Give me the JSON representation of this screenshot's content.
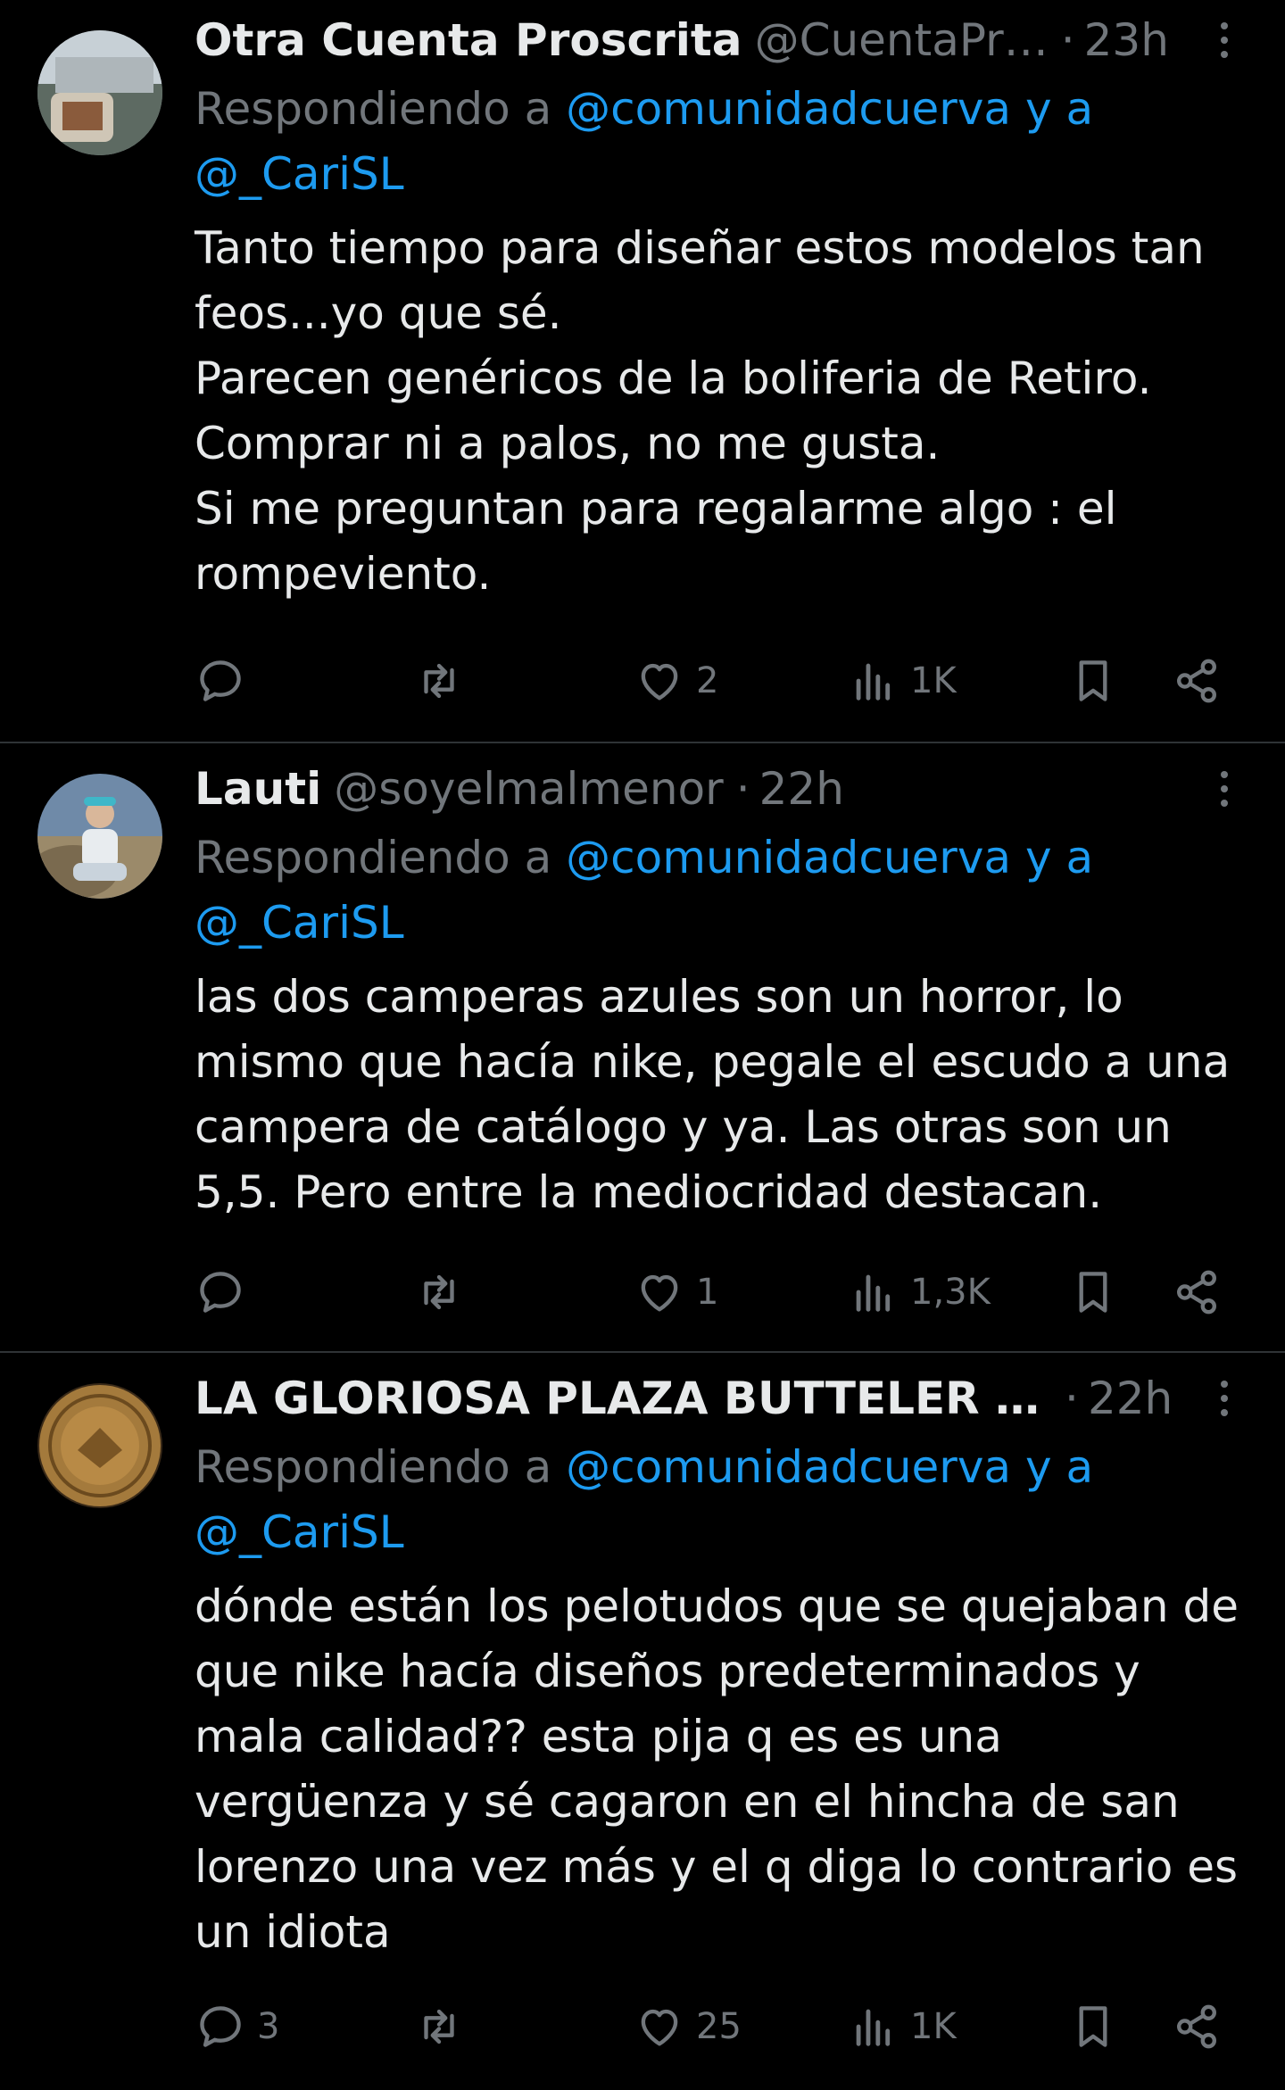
{
  "tweets": [
    {
      "name": "Otra Cuenta Proscrita",
      "handle": "@CuentaPr…",
      "time": "23h",
      "replying_prefix": "Respondiendo a ",
      "replying_mentions": "@comunidadcuerva y a",
      "replying_mentions2": "@_CariSL",
      "text": "Tanto tiempo para diseñar estos modelos tan feos...yo que sé.\nParecen genéricos de la boliferia de Retiro.\nComprar ni a palos, no me gusta.\nSi me preguntan para regalarme algo : el rompeviento.",
      "replies": "",
      "retweets": "",
      "likes": "2",
      "views": "1K"
    },
    {
      "name": "Lauti",
      "handle": "@soyelmalmenor",
      "time": "22h",
      "replying_prefix": "Respondiendo a ",
      "replying_mentions": "@comunidadcuerva y a",
      "replying_mentions2": "@_CariSL",
      "text": "las dos camperas azules son un horror, lo mismo que hacía nike, pegale el escudo a una campera de catálogo y ya. Las otras son un 5,5. Pero entre la mediocridad destacan.",
      "replies": "",
      "retweets": "",
      "likes": "1",
      "views": "1,3K"
    },
    {
      "name": "LA GLORIOSA PLAZA BUTTELER …",
      "handle": "",
      "time": "22h",
      "replying_prefix": "Respondiendo a ",
      "replying_mentions": "@comunidadcuerva y a",
      "replying_mentions2": "@_CariSL",
      "text": "dónde están los pelotudos que se quejaban de que nike hacía diseños predeterminados y mala calidad?? esta pija q es es una vergüenza y sé cagaron en el hincha de san lorenzo una vez más y el q diga lo contrario es un idiota",
      "replies": "3",
      "retweets": "",
      "likes": "25",
      "views": "1K"
    }
  ],
  "separator": "·",
  "colors": {
    "background": "#000000",
    "text": "#e7e9ea",
    "secondary": "#71767b",
    "link": "#1d9bf0",
    "divider": "#2f3336"
  }
}
